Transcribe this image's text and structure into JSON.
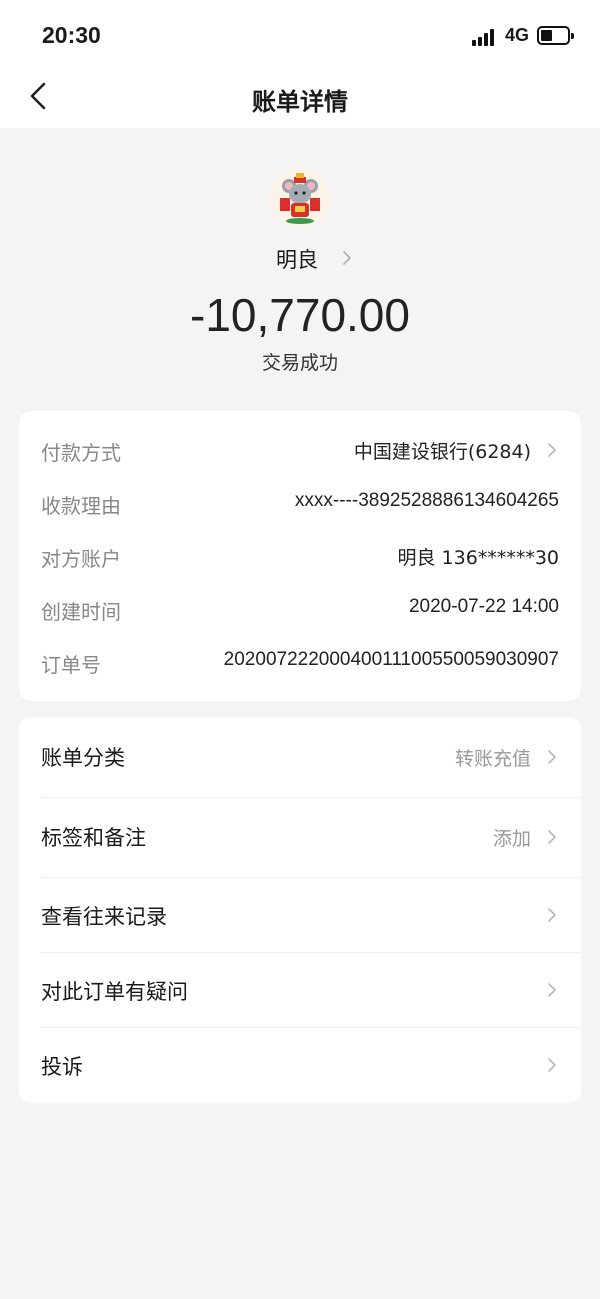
{
  "status_bar": {
    "time": "20:30",
    "network": "4G"
  },
  "nav": {
    "title": "账单详情"
  },
  "payee": {
    "name": "明良"
  },
  "transaction": {
    "amount": "-10,770.00",
    "status": "交易成功"
  },
  "details": [
    {
      "label": "付款方式",
      "value": "中国建设银行(6284)"
    },
    {
      "label": "收款理由",
      "value": "xxxx----3892528886134604265"
    },
    {
      "label": "对方账户",
      "value": "明良 136******30"
    },
    {
      "label": "创建时间",
      "value": "2020-07-22 14:00"
    },
    {
      "label": "订单号",
      "value": "20200722200040011100550059030907"
    }
  ],
  "menu": [
    {
      "label": "账单分类",
      "value": "转账充值"
    },
    {
      "label": "标签和备注",
      "value": "添加"
    },
    {
      "label": "查看往来记录",
      "value": ""
    },
    {
      "label": "对此订单有疑问",
      "value": ""
    },
    {
      "label": "投诉",
      "value": ""
    }
  ],
  "icons": {
    "back": "chevron-left-icon",
    "chevron": "chevron-right-icon",
    "avatar": "mouse-mascot-avatar"
  },
  "colors": {
    "background": "#f4f4f4",
    "card": "#ffffff",
    "label_gray": "#888888"
  }
}
